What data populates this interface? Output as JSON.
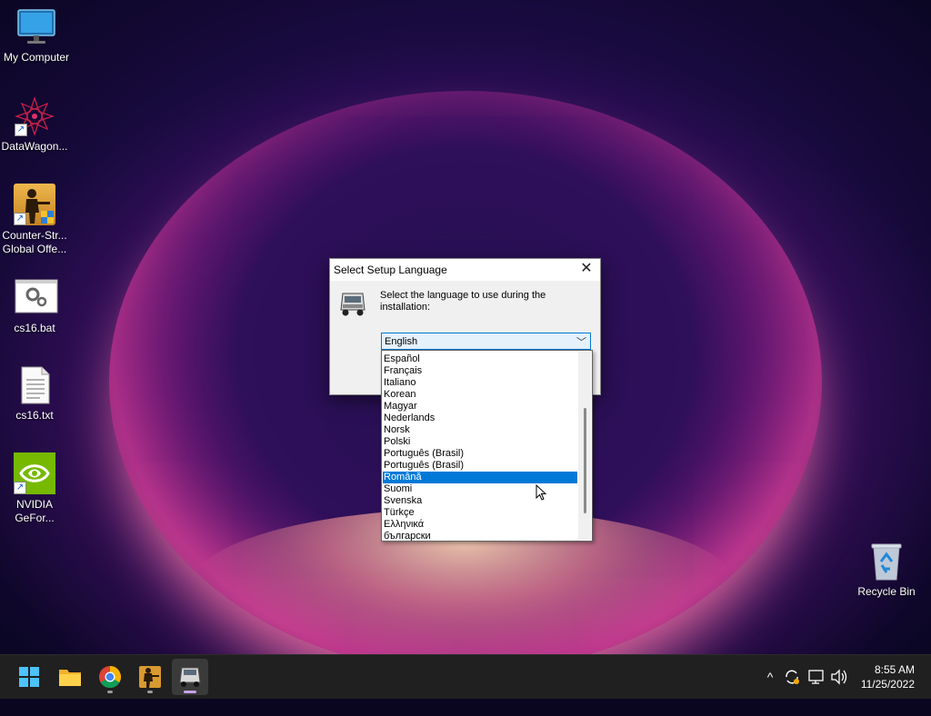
{
  "desktop": {
    "icons": [
      {
        "label": "My Computer",
        "icon": "monitor-icon"
      },
      {
        "label": "DataWagon...",
        "icon": "mandala-icon"
      },
      {
        "label": "Counter-Str... Global Offe...",
        "icon": "soldier-icon"
      },
      {
        "label": "cs16.bat",
        "icon": "gear-file-icon"
      },
      {
        "label": "cs16.txt",
        "icon": "text-file-icon"
      },
      {
        "label": "NVIDIA GeFor...",
        "icon": "nvidia-icon"
      },
      {
        "label": "Recycle Bin",
        "icon": "recycle-bin-icon"
      }
    ]
  },
  "dialog": {
    "title": "Select Setup Language",
    "prompt": "Select the language to use during the installation:",
    "selected_value": "English",
    "options": [
      "Español",
      "Français",
      "Italiano",
      "Korean",
      "Magyar",
      "Nederlands",
      "Norsk",
      "Polski",
      "Português (Brasil)",
      "Português (Brasil)",
      "Română",
      "Suomi",
      "Svenska",
      "Türkçe",
      "Ελληνικά",
      "български"
    ],
    "highlighted_option": "Română"
  },
  "taskbar": {
    "apps": [
      "start-icon",
      "file-explorer-icon",
      "chrome-icon",
      "counter-strike-icon",
      "truck-setup-icon"
    ],
    "clock_time": "8:55 AM",
    "clock_date": "11/25/2022",
    "tray_chevron": "^"
  },
  "colors": {
    "accent": "#0078d7",
    "taskbar": "#202020",
    "dialog_bg": "#f0f0f0"
  }
}
